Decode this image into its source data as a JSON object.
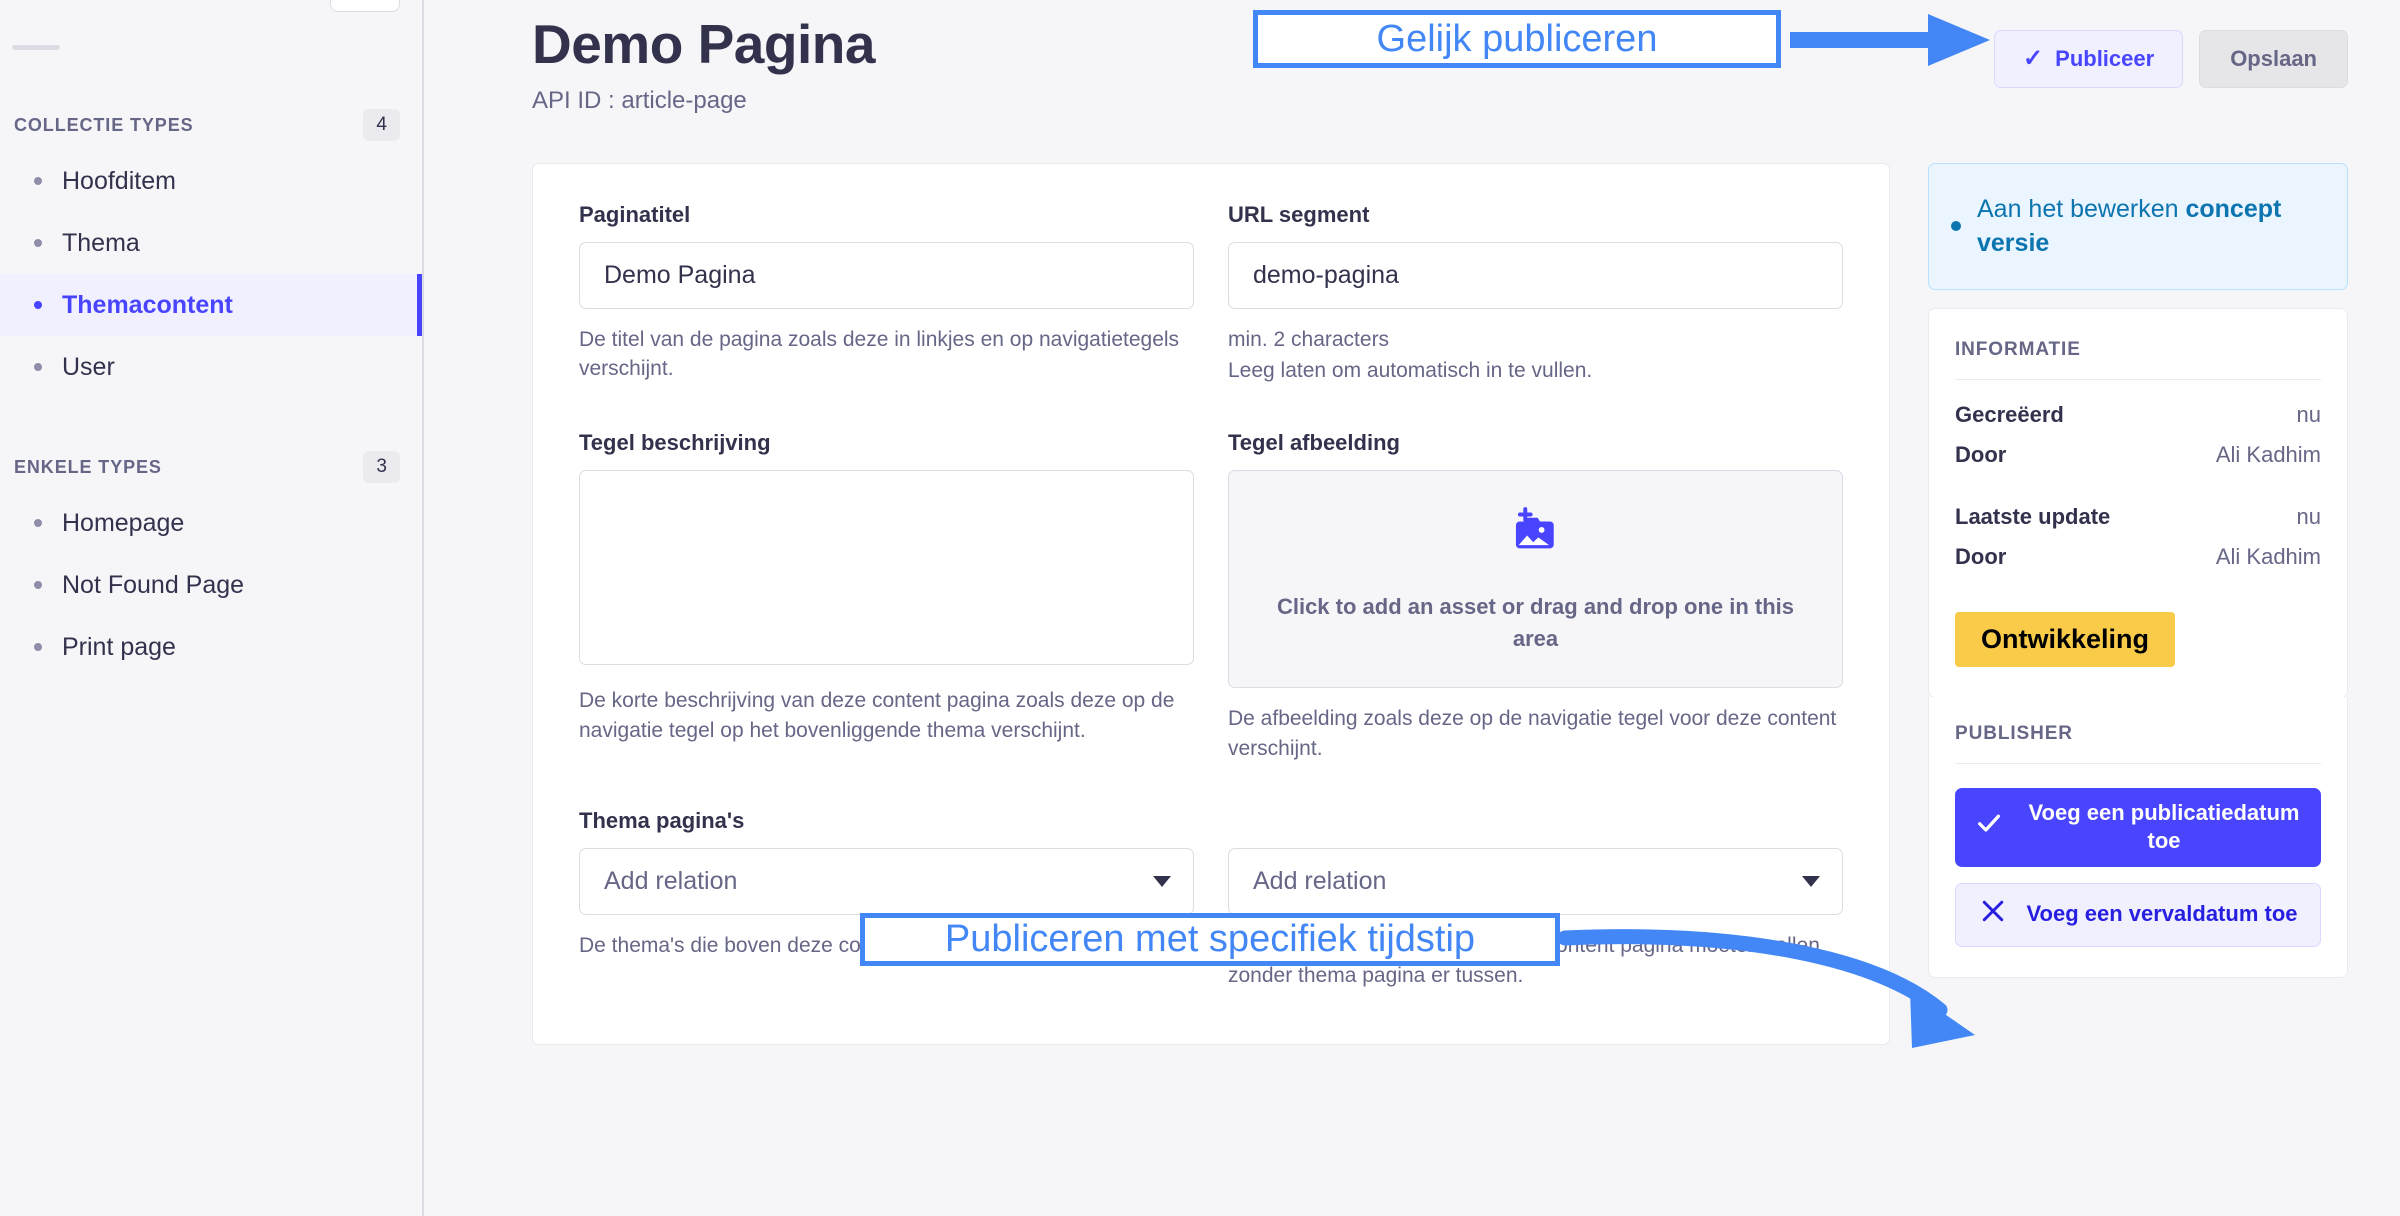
{
  "sidebar": {
    "sections": [
      {
        "title": "COLLECTIE TYPES",
        "count": "4",
        "items": [
          {
            "label": "Hoofditem",
            "active": false
          },
          {
            "label": "Thema",
            "active": false
          },
          {
            "label": "Themacontent",
            "active": true
          },
          {
            "label": "User",
            "active": false
          }
        ]
      },
      {
        "title": "ENKELE TYPES",
        "count": "3",
        "items": [
          {
            "label": "Homepage",
            "active": false
          },
          {
            "label": "Not Found Page",
            "active": false
          },
          {
            "label": "Print page",
            "active": false
          }
        ]
      }
    ]
  },
  "header": {
    "title": "Demo Pagina",
    "subtitle": "API ID : article-page",
    "publish_label": "Publiceer",
    "publish_icon": "check-icon",
    "save_label": "Opslaan"
  },
  "form": {
    "paginatitel": {
      "label": "Paginatitel",
      "value": "Demo Pagina",
      "placeholder": "",
      "hint": "De titel van de pagina zoals deze in linkjes en op navigatietegels verschijnt."
    },
    "url_segment": {
      "label": "URL segment",
      "value": "demo-pagina",
      "placeholder": "",
      "hint_line1": "min. 2 characters",
      "hint_line2": "Leeg laten om automatisch in te vullen."
    },
    "tegel_beschrijving": {
      "label": "Tegel beschrijving",
      "value": "",
      "placeholder": "",
      "hint": "De korte beschrijving van deze content pagina zoals deze op de navigatie tegel op het bovenliggende thema verschijnt."
    },
    "tegel_afbeelding": {
      "label": "Tegel afbeelding",
      "dropzone_text": "Click to add an asset or drag and drop one in this area",
      "dropzone_icon": "add-image-icon",
      "hint": "De afbeelding zoals deze op de navigatie tegel voor deze content verschijnt."
    },
    "thema_paginas": {
      "label": "Thema pagina's",
      "value": "Add relation",
      "hint": "De thema's die boven deze content pagina vallen."
    },
    "hoofditems": {
      "label": "",
      "value": "Add relation",
      "hint": "Hoofditems die direct boven deze content pagina moeten vallen zonder thema pagina er tussen."
    }
  },
  "rightpanel": {
    "draft": {
      "text_before": "Aan het bewerken ",
      "text_bold": "concept versie",
      "text_after": ""
    },
    "info": {
      "heading": "INFORMATIE",
      "rows": [
        {
          "key": "Gecreëerd",
          "value": "nu"
        },
        {
          "key": "Door",
          "value": "Ali Kadhim"
        },
        {
          "key": "Laatste update",
          "value": "nu"
        },
        {
          "key": "Door",
          "value": "Ali Kadhim"
        }
      ],
      "badge": "Ontwikkeling"
    },
    "publisher": {
      "heading": "PUBLISHER",
      "add_publish_date_label": "Voeg een publicatiedatum toe",
      "add_publish_date_icon": "check-icon",
      "add_expiry_date_label": "Voeg een vervaldatum toe",
      "add_expiry_date_icon": "close-x-icon"
    }
  },
  "annotations": {
    "publish_now": "Gelijk publiceren",
    "publish_scheduled": "Publiceren met specifiek tijdstip"
  },
  "colors": {
    "accent": "#4945ff",
    "annotation": "#4287f5",
    "badge_dev": "#f9cb48",
    "draft_blue": "#0c75af"
  }
}
